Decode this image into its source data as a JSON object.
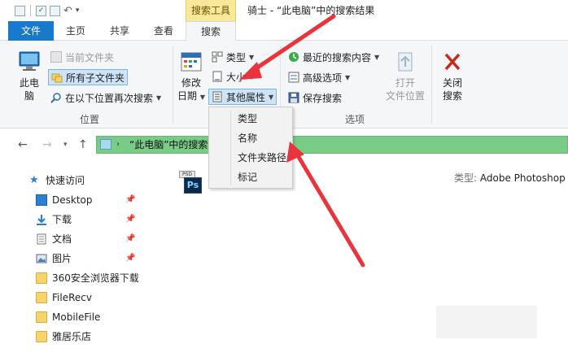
{
  "window": {
    "context_tab": "搜索工具",
    "title": "骑士 - “此电脑”中的搜索结果"
  },
  "tabs": {
    "file": "文件",
    "home": "主页",
    "share": "共享",
    "view": "查看",
    "search": "搜索"
  },
  "ribbon": {
    "location": {
      "this_pc": [
        "此电",
        "脑"
      ],
      "current_folder": "当前文件夹",
      "all_subfolders": "所有子文件夹",
      "search_again": "在以下位置再次搜索",
      "label": "位置"
    },
    "refine": {
      "modified_date": [
        "修改",
        "日期"
      ],
      "type": "类型",
      "size": "大小",
      "other_props": "其他属性"
    },
    "options": {
      "recent_searches": "最近的搜索内容",
      "advanced": "高级选项",
      "save_search": "保存搜索",
      "open_location": [
        "打开",
        "文件位置"
      ],
      "close_search": [
        "关闭",
        "搜索"
      ],
      "label": "选项"
    }
  },
  "dropdown": {
    "items": [
      "类型",
      "名称",
      "文件夹路径",
      "标记"
    ]
  },
  "address": {
    "path": "“此电脑”中的搜索结"
  },
  "nav": {
    "quick_access": "快速访问",
    "items": [
      {
        "label": "Desktop",
        "pinned": true
      },
      {
        "label": "下载",
        "pinned": true
      },
      {
        "label": "文档",
        "pinned": true
      },
      {
        "label": "图片",
        "pinned": true
      },
      {
        "label": "360安全浏览器下载",
        "pinned": false
      },
      {
        "label": "FileRecv",
        "pinned": false
      },
      {
        "label": "MobileFile",
        "pinned": false
      },
      {
        "label": "雅居乐店",
        "pinned": false
      }
    ]
  },
  "content": {
    "file_icon_text": "PSD",
    "file_icon_letters": "Ps",
    "type_key": "类型:",
    "type_value": "Adobe Photoshop"
  },
  "colors": {
    "file_tab": "#1979ca",
    "context_tab": "#f9e79a",
    "address_bg": "#78cc86",
    "arrow": "#e8343a"
  }
}
